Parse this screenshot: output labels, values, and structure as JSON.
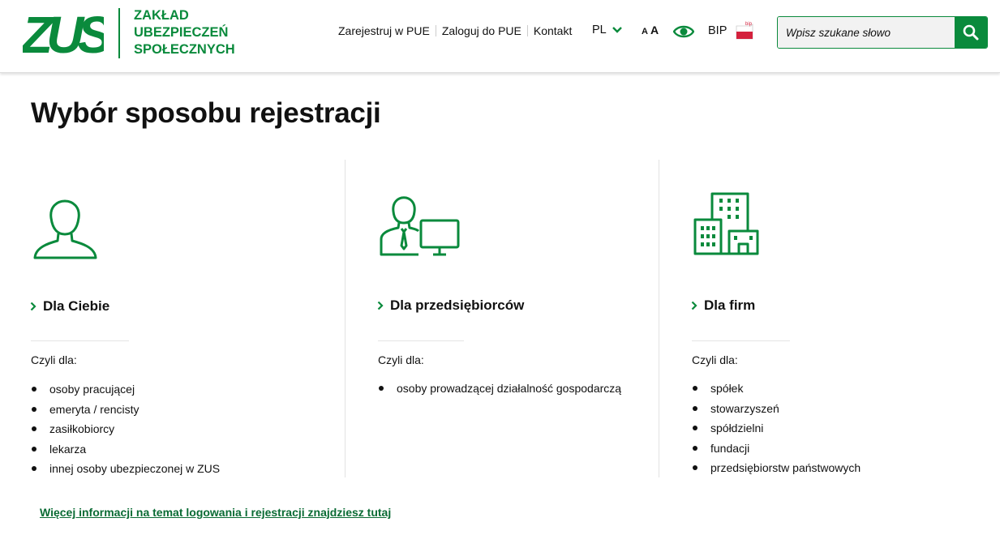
{
  "brand": {
    "logo_text": "ZUS",
    "name_lines": [
      "ZAKŁAD",
      "UBEZPIECZEŃ",
      "SPOŁECZNYCH"
    ],
    "color": "#0a8a3c"
  },
  "topnav": {
    "links": [
      "Zarejestruj w PUE",
      "Zaloguj do PUE",
      "Kontakt"
    ],
    "language": "PL",
    "font_small": "A",
    "font_big": "A",
    "bip": "BIP",
    "bip_flag_text": "bip",
    "icons": [
      "chevron-down-icon",
      "eye-icon",
      "bip-flag-icon",
      "search-icon"
    ]
  },
  "search": {
    "placeholder": "Wpisz szukane słowo"
  },
  "page": {
    "title": "Wybór sposobu rejestracji"
  },
  "columns": [
    {
      "icon": "person-icon",
      "link": "Dla Ciebie",
      "subtitle": "Czyli dla:",
      "items": [
        "osoby pracującej",
        "emeryta / rencisty",
        "zasiłkobiorcy",
        "lekarza",
        "innej osoby ubezpieczonej w ZUS"
      ]
    },
    {
      "icon": "entrepreneur-computer-icon",
      "link": "Dla przedsiębiorców",
      "subtitle": "Czyli dla:",
      "items": [
        "osoby prowadzącej działalność gospodarczą"
      ]
    },
    {
      "icon": "company-buildings-icon",
      "link": "Dla firm",
      "subtitle": "Czyli dla:",
      "items": [
        "spółek",
        "stowarzyszeń",
        "spółdzielni",
        "fundacji",
        "przedsiębiorstw państwowych"
      ]
    }
  ],
  "footer": {
    "more_info": "Więcej informacji na temat logowania i rejestracji znajdziesz tutaj"
  }
}
